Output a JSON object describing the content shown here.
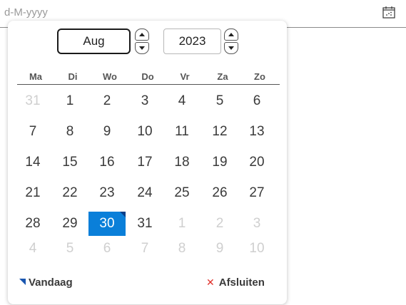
{
  "date_input": {
    "placeholder": "d-M-yyyy",
    "icon": "calendar-icon"
  },
  "datepicker": {
    "month": "Aug",
    "year": "2023",
    "weekdays": [
      "Ma",
      "Di",
      "Wo",
      "Do",
      "Vr",
      "Za",
      "Zo"
    ],
    "weeks": [
      [
        {
          "d": "31",
          "other": true
        },
        {
          "d": "1"
        },
        {
          "d": "2"
        },
        {
          "d": "3"
        },
        {
          "d": "4"
        },
        {
          "d": "5"
        },
        {
          "d": "6"
        }
      ],
      [
        {
          "d": "7"
        },
        {
          "d": "8"
        },
        {
          "d": "9"
        },
        {
          "d": "10"
        },
        {
          "d": "11"
        },
        {
          "d": "12"
        },
        {
          "d": "13"
        }
      ],
      [
        {
          "d": "14"
        },
        {
          "d": "15"
        },
        {
          "d": "16"
        },
        {
          "d": "17"
        },
        {
          "d": "18"
        },
        {
          "d": "19"
        },
        {
          "d": "20"
        }
      ],
      [
        {
          "d": "21"
        },
        {
          "d": "22"
        },
        {
          "d": "23"
        },
        {
          "d": "24"
        },
        {
          "d": "25"
        },
        {
          "d": "26"
        },
        {
          "d": "27"
        }
      ],
      [
        {
          "d": "28"
        },
        {
          "d": "29"
        },
        {
          "d": "30",
          "selected": true,
          "today": true
        },
        {
          "d": "31"
        },
        {
          "d": "1",
          "other": true
        },
        {
          "d": "2",
          "other": true
        },
        {
          "d": "3",
          "other": true
        }
      ],
      [
        {
          "d": "4",
          "other": true
        },
        {
          "d": "5",
          "other": true
        },
        {
          "d": "6",
          "other": true
        },
        {
          "d": "7",
          "other": true
        },
        {
          "d": "8",
          "other": true
        },
        {
          "d": "9",
          "other": true
        },
        {
          "d": "10",
          "other": true
        }
      ]
    ],
    "today_label": "Vandaag",
    "close_label": "Afsluiten"
  },
  "colors": {
    "selected": "#0a7fd9",
    "today_marker": "#1a56b0",
    "close_icon": "#e0302a"
  }
}
